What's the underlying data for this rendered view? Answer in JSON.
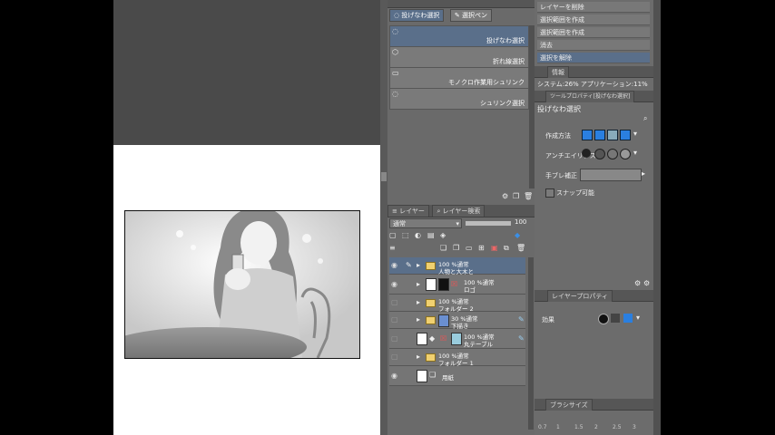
{
  "subtool": {
    "tabs": [
      "投げなわ選択",
      "選択ペン"
    ],
    "items": [
      "投げなわ選択",
      "折れ線選択",
      "モノクロ作業用シュリンク",
      "シュリンク選択"
    ]
  },
  "history": {
    "items": [
      "レイヤーを削除",
      "選択範囲を作成",
      "選択範囲を作成",
      "消去",
      "選択を解除"
    ],
    "info_tab": "情報",
    "system_text": "システム:26%  アプリケーション:11%"
  },
  "tool_property": {
    "tab": "ツールプロパティ[投げなわ選択]",
    "title": "投げなわ選択",
    "rows": {
      "mode_label": "作成方法",
      "antialias_label": "アンチエイリアス",
      "stabilize_label": "手ブレ補正",
      "snap_label": "スナップ可能"
    }
  },
  "layer_property": {
    "tab": "レイヤープロパティ",
    "effect_label": "効果"
  },
  "brush_size": {
    "tab": "ブラシサイズ",
    "values": [
      "0.7",
      "1",
      "1.5",
      "2",
      "2.5",
      "3"
    ]
  },
  "layers": {
    "tabs": [
      "レイヤー",
      "レイヤー検索"
    ],
    "blend_mode": "通常",
    "opacity": "100",
    "rows": [
      {
        "line1": "100 %通常",
        "line2": "人物と大木と"
      },
      {
        "line1": "100 %通常",
        "line2": "ロゴ"
      },
      {
        "line1": "100 %通常",
        "line2": "フォルダー 2"
      },
      {
        "line1": "30 %通常",
        "line2": "下描き"
      },
      {
        "line1": "100 %通常",
        "line2": "丸テーブル"
      },
      {
        "line1": "100 %通常",
        "line2": "フォルダー 1"
      },
      {
        "line1": "",
        "line2": "用紙"
      }
    ]
  },
  "colors": {
    "panel": "#6a6a6a",
    "selected": "#5a6f8a",
    "accent_blue": "#2a7fe0"
  }
}
